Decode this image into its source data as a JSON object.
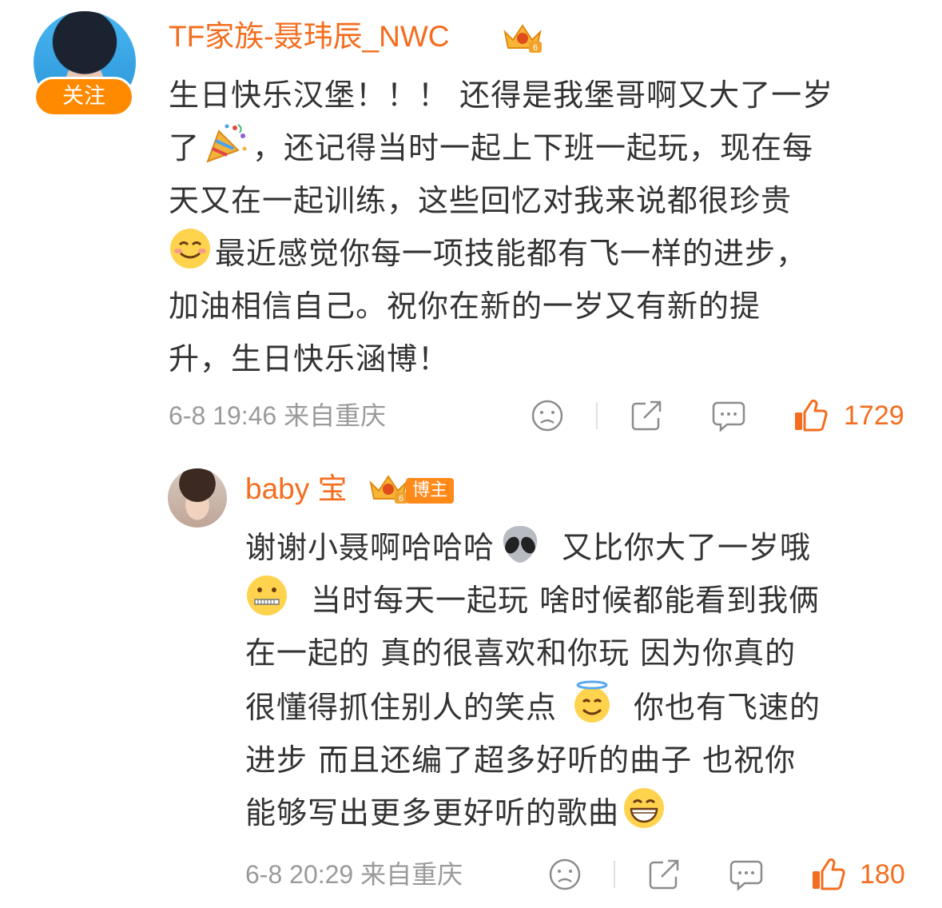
{
  "comment": {
    "username": "TF家族-聂玮辰_NWC",
    "follow_label": "关注",
    "lines": [
      "生日快乐汉堡！！！ 还得是我堡哥啊又大了一岁",
      "了",
      "，还记得当时一起上下班一起玩，现在每",
      "天又在一起训练，这些回忆对我来说都很珍贵",
      "最近感觉你每一项技能都有飞一样的进步，",
      "加油相信自己。祝你在新的一岁又有新的提",
      "升，生日快乐涵博！"
    ],
    "time": "6-8 19:46",
    "location": "来自重庆",
    "like_count": "1729"
  },
  "reply": {
    "username": "baby 宝",
    "badge": "博主",
    "lines": [
      "谢谢小聂啊哈哈哈",
      "又比你大了一岁哦",
      "当时每天一起玩 啥时候都能看到我俩",
      "在一起的 真的很喜欢和你玩 因为你真的",
      "很懂得抓住别人的笑点",
      "你也有飞速的",
      "进步 而且还编了超多好听的曲子 也祝你",
      "能够写出更多更好听的歌曲"
    ],
    "time": "6-8 20:29",
    "location": "来自重庆",
    "like_count": "180"
  },
  "icons": [
    "dislike-face-icon",
    "share-icon",
    "comment-icon",
    "thumbs-up-icon",
    "party-popper-icon",
    "smiling-face-icon",
    "alien-icon",
    "zipper-mouth-icon",
    "halo-face-icon",
    "grinning-face-icon",
    "crown-icon"
  ],
  "colors": {
    "accent": "#f46d1e",
    "follow_button": "#ff8a00",
    "meta_gray": "#9a9a9a"
  }
}
